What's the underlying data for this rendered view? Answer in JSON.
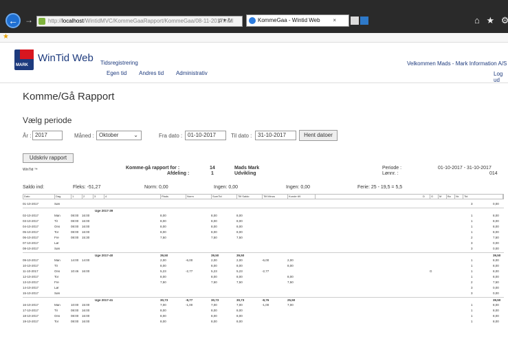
{
  "browser": {
    "url_prefix": "http://",
    "url_host": "localhost",
    "url_path": "/WintidMVC/KommeGaaRapport/KommeGaa/08-11-2017/null",
    "url_actions": "ρ ▾ ↻",
    "tab_title": "KommeGaa - Wintid Web",
    "tab_close": "×",
    "toolbar_icons": "⌂ ★ ⚙ ☺",
    "back_glyph": "←",
    "forward_glyph": "→",
    "favorites_glyph": "★",
    "new_tab_icon": "new-tab-icon",
    "extension_icon": "extension-icon"
  },
  "app": {
    "logo_text": "MARK",
    "brand": "WinTid Web",
    "nav_title": "Tidsregistrering",
    "nav_items": [
      "Egen tid",
      "Andres tid",
      "Administrativ"
    ],
    "welcome": "Velkommen Mads - Mark Information A/S",
    "logout": "Log ud",
    "colors": {
      "brand_blue": "#1d3a7d",
      "logo_red": "#d8161f"
    }
  },
  "page": {
    "title": "Komme/Gå Rapport",
    "period_title": "Vælg periode",
    "year_label": "År :",
    "year_value": "2017",
    "month_label": "Måned :",
    "month_value": "Oktober",
    "from_label": "Fra dato :",
    "from_value": "01-10-2017",
    "to_label": "Til dato :",
    "to_value": "31-10-2017",
    "fetch_button": "Hent datoer",
    "print_button": "Udskriv rapport"
  },
  "report": {
    "logo": "WinTid ™",
    "for_label": "Komme-gå rapport for :",
    "for_number": "14",
    "for_name": "Mads Mark",
    "dept_label": "Afdeling :",
    "dept_number": "1",
    "dept_name": "Udvikling",
    "period_label": "Periode :",
    "period_value": "01-10-2017 - 31-10-2017",
    "pay_label": "Lønnr. :",
    "pay_value": "014",
    "balance_in": "Saldo ind:",
    "flex": "Fleks: -51,27",
    "norm": "Norm: 0,00",
    "none1": "Ingen: 0,00",
    "none2": "Ingen: 0,00",
    "vacation": "Ferie: 25 - 19,5 = 5,5",
    "columns": [
      "Dato",
      "Dag",
      "1",
      "2",
      "3",
      "4",
      "Plads",
      "Norm",
      "SumTid",
      "Tilf Saldo",
      "Tilf Minus",
      "Kunde tilf.",
      "D",
      "G",
      "M",
      "Bo",
      "Nr.",
      "Tid"
    ],
    "rows": [
      {
        "date": "01-10-2017",
        "day": "Søn",
        "c1": "",
        "c2": "",
        "plads": "",
        "norm": "",
        "sum": "",
        "saldo": "",
        "minus": "",
        "kunde": "",
        "g": "",
        "nr": "3",
        "tid": "0,00"
      },
      {
        "week": "Uge 2017-39"
      },
      {
        "date": "02-10-2017",
        "day": "Man",
        "c1": "08:00",
        "c2": "16:00",
        "plads": "8,00",
        "norm": "",
        "sum": "8,00",
        "saldo": "8,00",
        "minus": "",
        "kunde": "",
        "g": "",
        "nr": "1",
        "tid": "8,00"
      },
      {
        "date": "03-10-2017",
        "day": "Tir",
        "c1": "08:00",
        "c2": "16:00",
        "plads": "8,00",
        "norm": "",
        "sum": "8,00",
        "saldo": "8,00",
        "minus": "",
        "kunde": "",
        "g": "",
        "nr": "1",
        "tid": "8,00"
      },
      {
        "date": "04-10-2017",
        "day": "Ons",
        "c1": "08:00",
        "c2": "16:00",
        "plads": "8,00",
        "norm": "",
        "sum": "8,00",
        "saldo": "8,00",
        "minus": "",
        "kunde": "",
        "g": "",
        "nr": "1",
        "tid": "8,00"
      },
      {
        "date": "05-10-2017",
        "day": "Tor",
        "c1": "08:00",
        "c2": "16:00",
        "plads": "8,00",
        "norm": "",
        "sum": "8,00",
        "saldo": "8,00",
        "minus": "",
        "kunde": "",
        "g": "",
        "nr": "1",
        "tid": "8,00"
      },
      {
        "date": "06-10-2017",
        "day": "Fre",
        "c1": "08:00",
        "c2": "15:30",
        "plads": "7,50",
        "norm": "",
        "sum": "7,50",
        "saldo": "7,50",
        "minus": "",
        "kunde": "",
        "g": "",
        "nr": "2",
        "tid": "7,50"
      },
      {
        "date": "07-10-2017",
        "day": "Lør",
        "c1": "",
        "c2": "",
        "plads": "",
        "norm": "",
        "sum": "",
        "saldo": "",
        "minus": "",
        "kunde": "",
        "g": "",
        "nr": "3",
        "tid": "0,00"
      },
      {
        "date": "08-10-2017",
        "day": "Søn",
        "c1": "",
        "c2": "",
        "plads": "",
        "norm": "",
        "sum": "",
        "saldo": "",
        "minus": "",
        "kunde": "",
        "g": "",
        "nr": "3",
        "tid": "0,00"
      },
      {
        "week": "Uge 2017-40",
        "plads": "39,50",
        "sum": "39,50",
        "saldo": "39,50",
        "tid": "39,50"
      },
      {
        "date": "09-10-2017",
        "day": "Man",
        "c1": "14:00",
        "c2": "14:00",
        "plads": "2,00",
        "norm": "-6,00",
        "sum": "2,00",
        "saldo": "2,00",
        "minus": "-6,00",
        "kunde": "2,00",
        "g": "",
        "nr": "1",
        "tid": "8,00"
      },
      {
        "date": "10-10-2017",
        "day": "Tir",
        "c1": "",
        "c2": "",
        "plads": "8,00",
        "norm": "",
        "sum": "8,00",
        "saldo": "8,00",
        "minus": "",
        "kunde": "8,00",
        "g": "",
        "nr": "1",
        "tid": "8,00"
      },
      {
        "date": "11-10-2017",
        "day": "Ons",
        "c1": "10:46",
        "c2": "16:00",
        "plads": "5,23",
        "norm": "-2,77",
        "sum": "5,23",
        "saldo": "5,23",
        "minus": "-2,77",
        "kunde": "",
        "g": "G",
        "nr": "1",
        "tid": "8,00"
      },
      {
        "date": "12-10-2017",
        "day": "Tor",
        "c1": "",
        "c2": "",
        "plads": "8,00",
        "norm": "",
        "sum": "8,00",
        "saldo": "8,00",
        "minus": "",
        "kunde": "8,00",
        "g": "",
        "nr": "1",
        "tid": "8,00"
      },
      {
        "date": "13-10-2017",
        "day": "Fre",
        "c1": "",
        "c2": "",
        "plads": "7,50",
        "norm": "",
        "sum": "7,50",
        "saldo": "7,50",
        "minus": "",
        "kunde": "7,50",
        "g": "",
        "nr": "2",
        "tid": "7,50"
      },
      {
        "date": "14-10-2017",
        "day": "Lør",
        "c1": "",
        "c2": "",
        "plads": "",
        "norm": "",
        "sum": "",
        "saldo": "",
        "minus": "",
        "kunde": "",
        "g": "",
        "nr": "3",
        "tid": "0,00"
      },
      {
        "date": "15-10-2017",
        "day": "Søn",
        "c1": "",
        "c2": "",
        "plads": "",
        "norm": "",
        "sum": "",
        "saldo": "",
        "minus": "",
        "kunde": "",
        "g": "",
        "nr": "3",
        "tid": "0,00"
      },
      {
        "week": "Uge 2017-41",
        "plads": "30,73",
        "norm": "-8,77",
        "sum": "30,73",
        "saldo": "30,73",
        "minus": "-8,76",
        "minus2": "-8,76",
        "kunde": "25,50",
        "tid": "39,50"
      },
      {
        "date": "16-10-2017",
        "day": "Man",
        "c1": "10:00",
        "c2": "15:00",
        "plads": "7,00",
        "norm": "-1,00",
        "sum": "7,00",
        "saldo": "7,00",
        "minus": "-1,00",
        "kunde": "7,00",
        "g": "",
        "nr": "1",
        "tid": "8,00"
      },
      {
        "date": "17-10-2017",
        "day": "Tir",
        "c1": "08:00",
        "c2": "16:00",
        "plads": "8,00",
        "norm": "",
        "sum": "8,00",
        "saldo": "8,00",
        "minus": "",
        "kunde": "",
        "g": "",
        "nr": "1",
        "tid": "8,00"
      },
      {
        "date": "18-10-2017",
        "day": "Ons",
        "c1": "08:00",
        "c2": "16:00",
        "plads": "8,00",
        "norm": "",
        "sum": "8,00",
        "saldo": "8,00",
        "minus": "",
        "kunde": "",
        "g": "",
        "nr": "1",
        "tid": "8,00"
      },
      {
        "date": "19-10-2017",
        "day": "Tor",
        "c1": "08:00",
        "c2": "16:00",
        "plads": "8,00",
        "norm": "",
        "sum": "8,00",
        "saldo": "8,00",
        "minus": "",
        "kunde": "",
        "g": "",
        "nr": "1",
        "tid": "8,00"
      }
    ]
  }
}
